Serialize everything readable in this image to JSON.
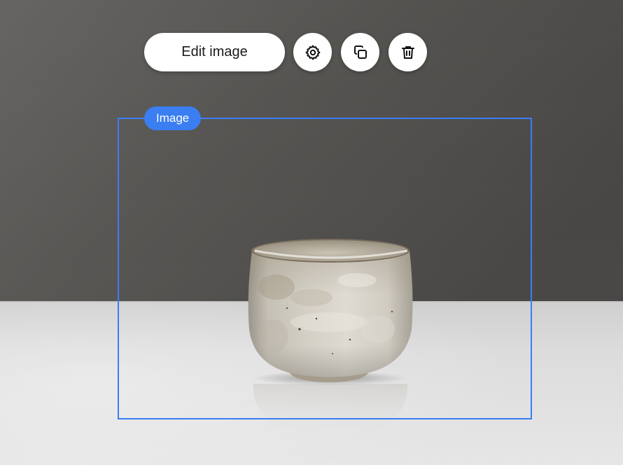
{
  "toolbar": {
    "edit_label": "Edit image",
    "settings_icon": "gear-icon",
    "duplicate_icon": "duplicate-icon",
    "delete_icon": "trash-icon"
  },
  "selection": {
    "tag_label": "Image",
    "accent_color": "#3a7ef2"
  },
  "photo": {
    "subject": "ceramic-cup-icon"
  }
}
